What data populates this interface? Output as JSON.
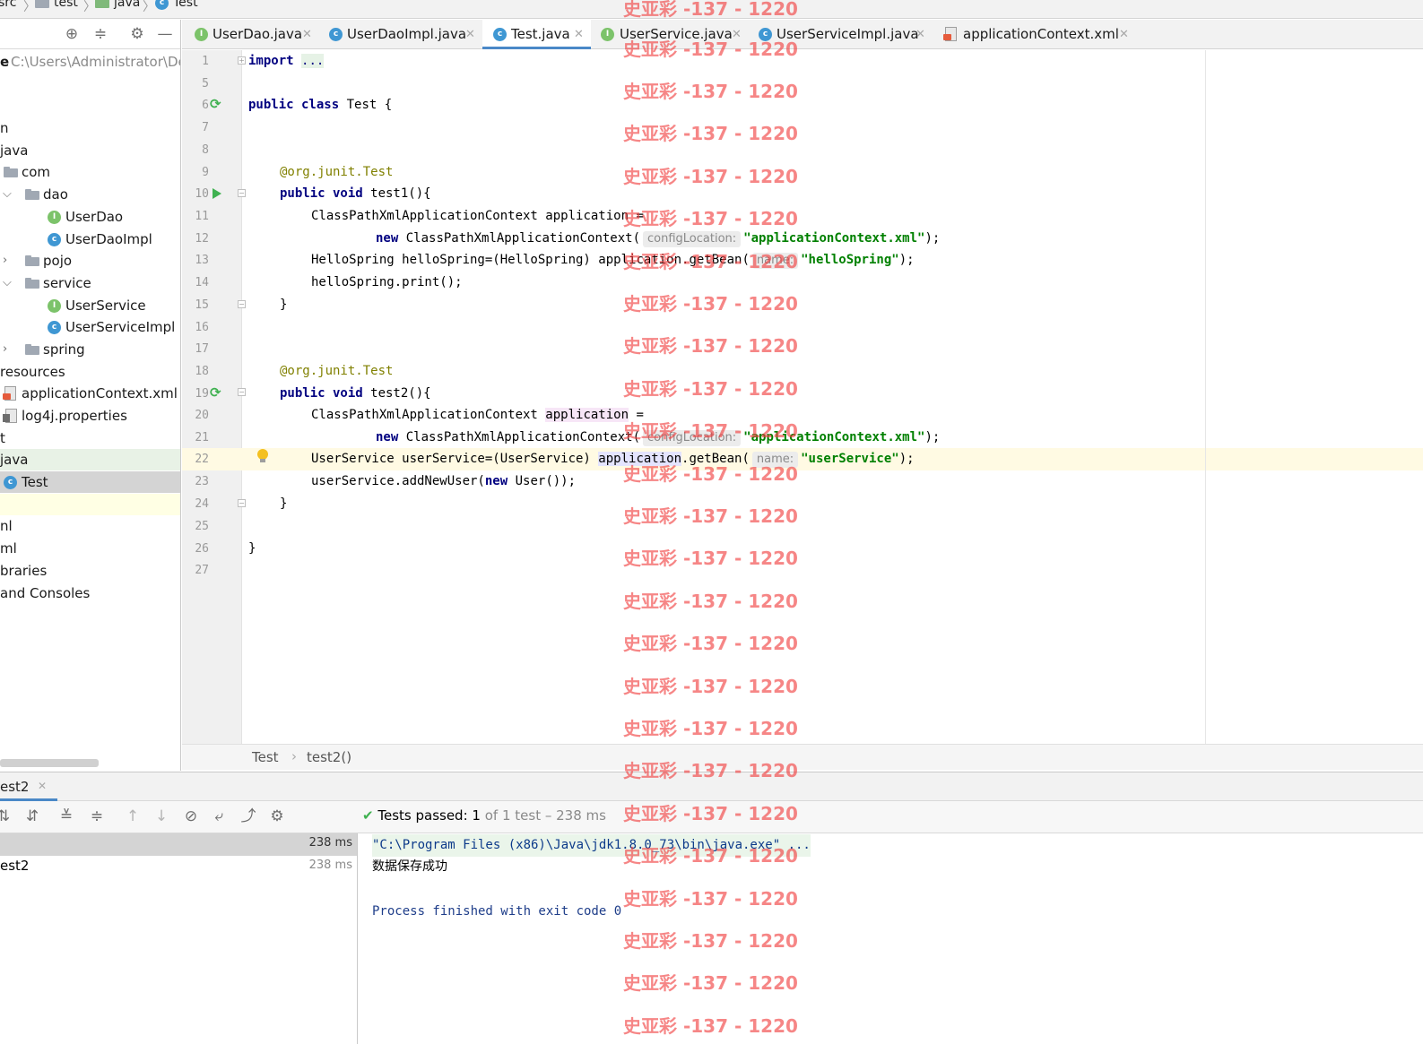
{
  "breadcrumb": {
    "items": [
      "src",
      "test",
      "java",
      "Test"
    ]
  },
  "project": {
    "path_label": "e",
    "path_value": "C:\\Users\\Administrator\\De",
    "tree": {
      "main_cut": "n",
      "java": "java",
      "com": "com",
      "dao": "dao",
      "userdao": "UserDao",
      "userdaoimpl": "UserDaoImpl",
      "pojo": "pojo",
      "service": "service",
      "userservice": "UserService",
      "userserviceimpl": "UserServiceImpl",
      "spring": "spring",
      "resources": "resources",
      "appctx": "applicationContext.xml",
      "log4j": "log4j.properties",
      "test_cut": "t",
      "test_java": "java",
      "test_class": "Test",
      "iml_cut1": "nl",
      "iml_cut2": "ml",
      "libraries": "braries",
      "consoles": "and Consoles"
    }
  },
  "tabs": [
    {
      "label": "UserDao.java",
      "icon": "interface-icon"
    },
    {
      "label": "UserDaoImpl.java",
      "icon": "class-icon"
    },
    {
      "label": "Test.java",
      "icon": "class-icon"
    },
    {
      "label": "UserService.java",
      "icon": "interface-icon"
    },
    {
      "label": "UserServiceImpl.java",
      "icon": "class-icon"
    },
    {
      "label": "applicationContext.xml",
      "icon": "xml-icon"
    }
  ],
  "code": {
    "line_numbers": [
      "1",
      "5",
      "6",
      "7",
      "8",
      "9",
      "10",
      "11",
      "12",
      "13",
      "14",
      "15",
      "16",
      "17",
      "18",
      "19",
      "20",
      "21",
      "22",
      "23",
      "24",
      "25",
      "26",
      "27"
    ],
    "l1_kw": "import",
    "l1_dots": "...",
    "l6_kw": "public class",
    "l6_rest": " Test {",
    "ann_prefix": "@org.junit.",
    "ann_name": "Test",
    "method_kw": "public void",
    "test1_sig": " test1(){",
    "test2_sig": " test2(){",
    "ctx_decl": "ClassPathXmlApplicationContext ",
    "application": "application",
    "assign": " =",
    "new_kw": "new",
    "ctx_ctor": " ClassPathXmlApplicationContext(",
    "hint_config": "configLocation:",
    "str_appctx": "\"applicationContext.xml\"",
    "close_paren_semi": ");",
    "hello_decl": "HelloSpring helloSpring=(HelloSpring) ",
    "get_bean": ".getBean(",
    "hint_name": "name:",
    "str_hello": "\"helloSpring\"",
    "hello_print": "helloSpring.print();",
    "brace_close": "}",
    "us_decl": "UserService userService=(UserService) ",
    "str_us": "\"userService\"",
    "us_call_a": "userService.addNewUser(",
    "us_call_b": " User());"
  },
  "editor_breadcrumb": {
    "class": "Test",
    "method": "test2()"
  },
  "run": {
    "tab_label": "est2",
    "status_passed": "Tests passed:",
    "status_count": "1",
    "status_rest": "of 1 test – 238 ms",
    "tree_root_time": "238 ms",
    "tree_item": "est2",
    "tree_item_time": "238 ms"
  },
  "console": {
    "cmd": "\"C:\\Program Files (x86)\\Java\\jdk1.8.0_73\\bin\\java.exe\" ...",
    "output": "数据保存成功",
    "exit": "Process finished with exit code 0"
  },
  "watermark": {
    "text": "史亚彩 -137 - 1220"
  },
  "colors": {
    "keyword": "#000080",
    "string": "#008000",
    "annotation": "#808000",
    "current_line": "#fffae3",
    "pass_green": "#3fb150",
    "watermark": "#f03c3c"
  }
}
